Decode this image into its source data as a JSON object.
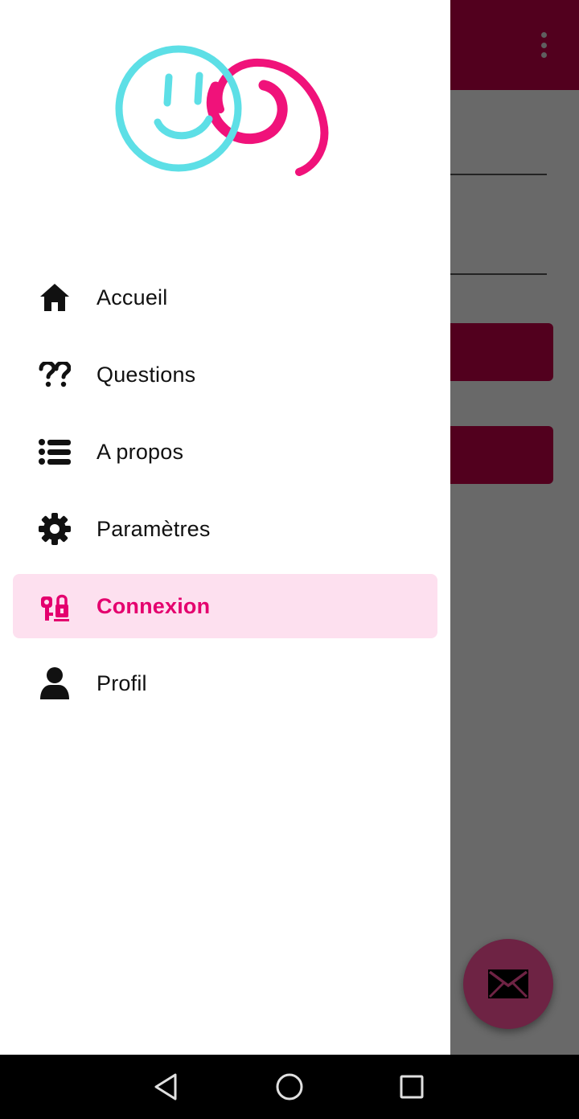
{
  "colors": {
    "brand": "#c7004a",
    "accent_pink": "#e4006e",
    "logo_cyan": "#5ddfe6",
    "logo_pink": "#f0127a",
    "active_bg": "#fde0ef"
  },
  "drawer": {
    "logo": "app-logo",
    "items": [
      {
        "label": "Accueil",
        "icon": "home-icon",
        "active": false
      },
      {
        "label": "Questions",
        "icon": "double-question-icon",
        "active": false
      },
      {
        "label": "A propos",
        "icon": "list-icon",
        "active": false
      },
      {
        "label": "Paramètres",
        "icon": "gear-icon",
        "active": false
      },
      {
        "label": "Connexion",
        "icon": "login-key-lock-icon",
        "active": true
      },
      {
        "label": "Profil",
        "icon": "user-icon",
        "active": false
      }
    ]
  },
  "app_bar": {
    "menu_icon": "more-vert-icon"
  },
  "fab": {
    "icon": "email-icon"
  },
  "navbar": {
    "back_icon": "back-triangle-icon",
    "home_icon": "home-circle-icon",
    "recents_icon": "recents-square-icon"
  }
}
